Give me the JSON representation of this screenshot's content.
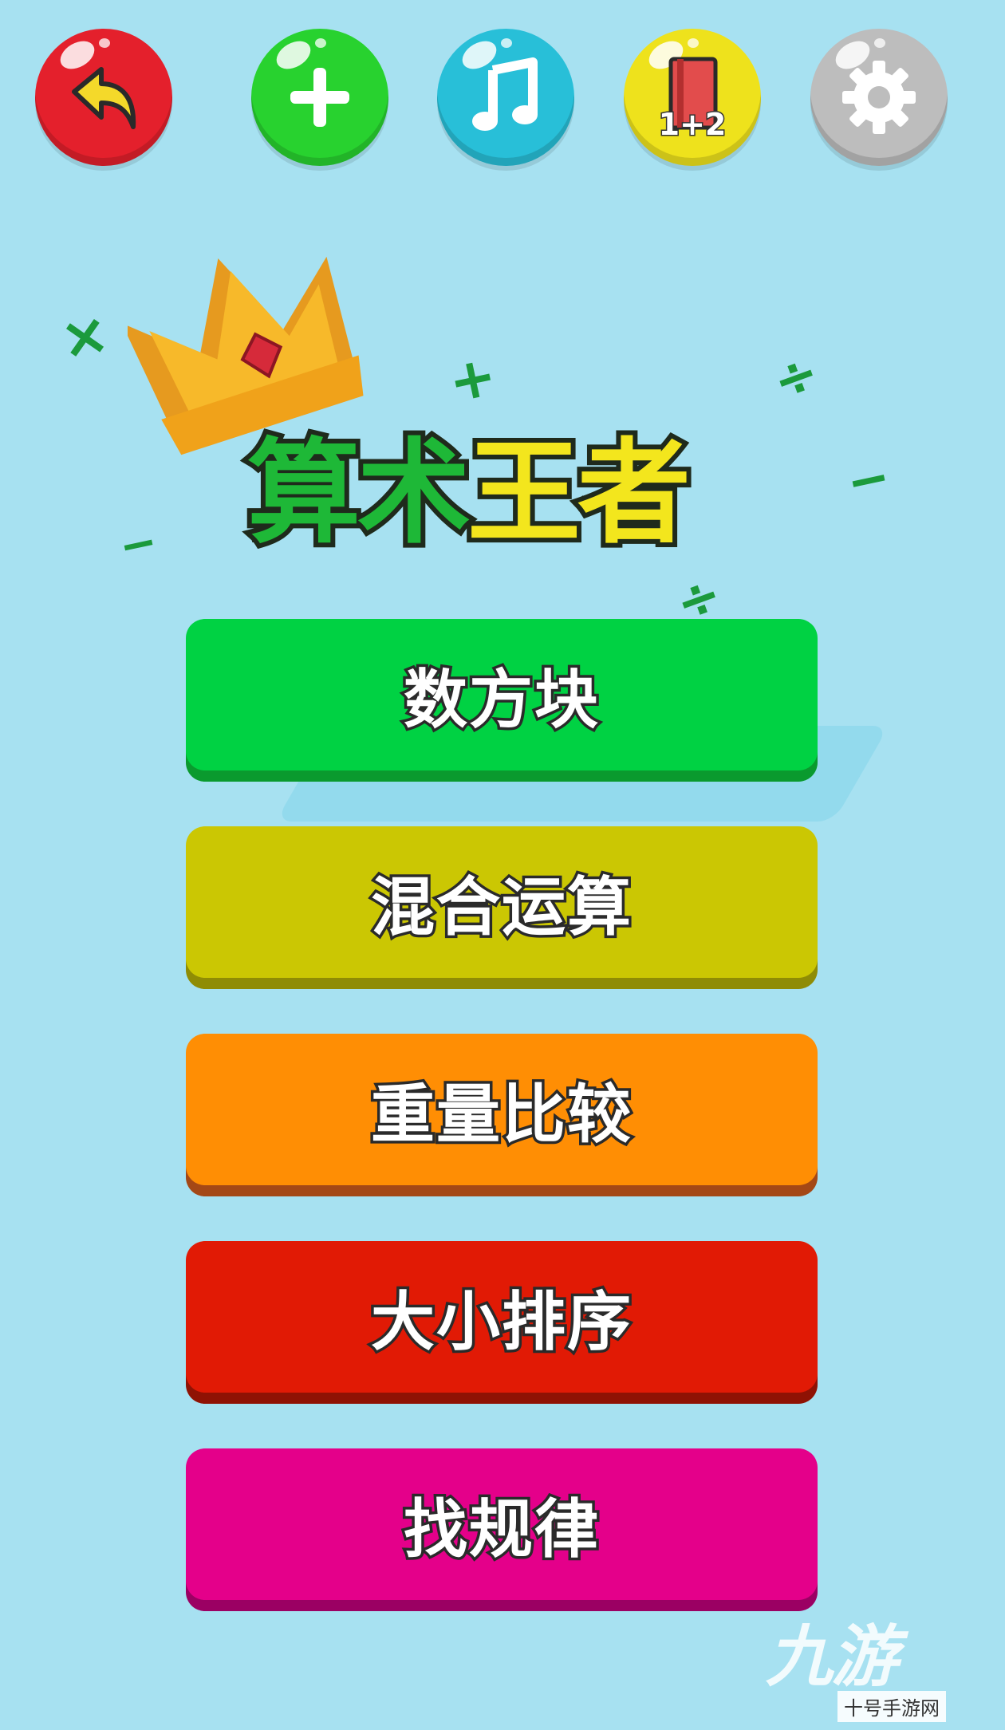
{
  "title": {
    "part1": "算术",
    "part2": "王者"
  },
  "top_bar": {
    "back": {
      "icon": "back-arrow-icon",
      "color": "#e4202c"
    },
    "add": {
      "icon": "plus-icon",
      "color": "#28d22f"
    },
    "music": {
      "icon": "music-note-icon",
      "color": "#28bfd8"
    },
    "book": {
      "icon": "book-icon",
      "badge": "1+2",
      "color": "#eee21c"
    },
    "settings": {
      "icon": "gear-icon",
      "color": "#bdbdbd"
    }
  },
  "decor_symbols": [
    "×",
    "+",
    "÷",
    "−",
    "−",
    "÷"
  ],
  "menu": [
    {
      "label": "数方块",
      "color": "#00d243"
    },
    {
      "label": "混合运算",
      "color": "#cbc703"
    },
    {
      "label": "重量比较",
      "color": "#ff8e04"
    },
    {
      "label": "大小排序",
      "color": "#e11a05"
    },
    {
      "label": "找规律",
      "color": "#e4008a"
    }
  ],
  "watermark": {
    "logo": "九游",
    "site": "十号手游网"
  }
}
